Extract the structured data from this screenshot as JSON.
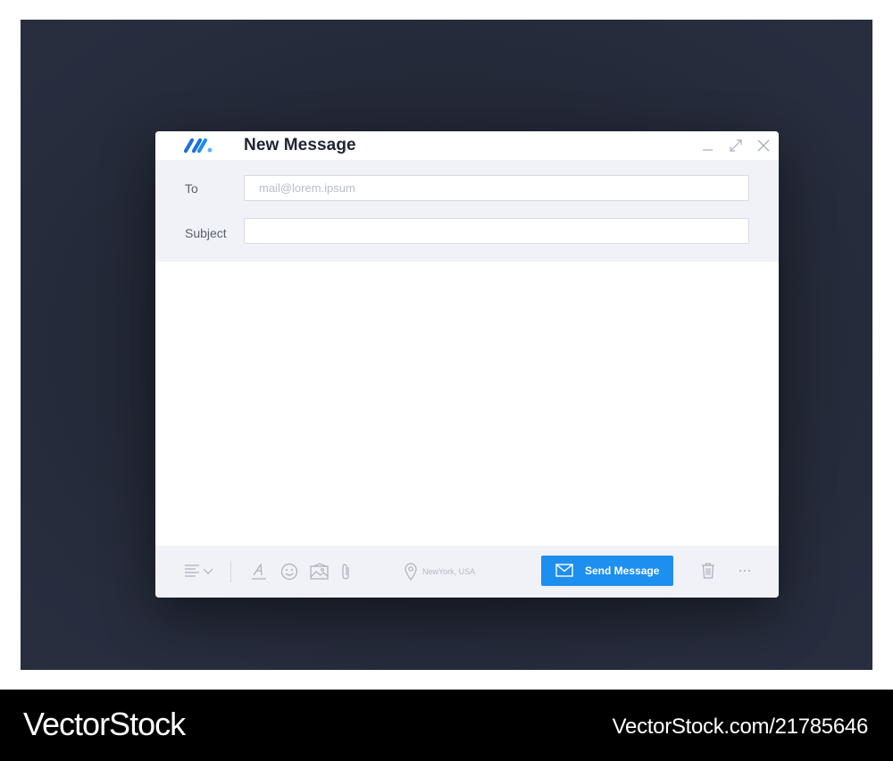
{
  "window": {
    "title": "New Message",
    "accent_color": "#1c8fef"
  },
  "controls": {
    "minimize_icon": "minimize-icon",
    "maximize_icon": "maximize-icon",
    "close_icon": "close-icon"
  },
  "fields": {
    "to_label": "To",
    "to_placeholder": "mail@lorem.ipsum",
    "to_value": "",
    "subject_label": "Subject",
    "subject_value": ""
  },
  "body": {
    "value": ""
  },
  "toolbar": {
    "align_icon": "text-align-icon",
    "font_icon": "text-format-icon",
    "emoji_icon": "emoji-icon",
    "image_icon": "image-icon",
    "attach_icon": "paperclip-icon",
    "location_text": "NewYork, USA",
    "send_label": "Send Message",
    "trash_icon": "trash-icon",
    "more_icon": "more-icon"
  },
  "watermark": {
    "brand": "VectorStock",
    "url": "VectorStock.com/21785646"
  }
}
